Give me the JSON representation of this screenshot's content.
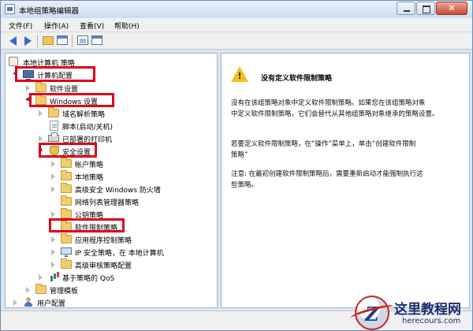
{
  "window": {
    "title": "本地组策略编辑器"
  },
  "menu": [
    {
      "label": "文件(F)"
    },
    {
      "label": "操作(A)"
    },
    {
      "label": "查看(V)"
    },
    {
      "label": "帮助(H)"
    }
  ],
  "tree": {
    "root": "本地计算机 策略",
    "computer_config": "计算机配置",
    "software_settings": "软件设置",
    "windows_settings": "Windows 设置",
    "dns_policy": "域名解析策略",
    "scripts": "脚本(启动/关机)",
    "printers": "已部署的打印机",
    "security_settings": "安全设置",
    "account_policies": "帐户策略",
    "local_policies": "本地策略",
    "firewall": "高级安全 Windows 防火墙",
    "network_list": "网络列表管理器策略",
    "public_key": "公钥策略",
    "software_restriction": "软件限制策略",
    "applocker": "应用程序控制策略",
    "ipsec": "IP 安全策略，在 本地计算机",
    "audit": "高级审核策略配置",
    "qos": "基于策略的 QoS",
    "admin_templates": "管理模板",
    "user_config": "用户配置"
  },
  "detail": {
    "title": "没有定义软件限制策略",
    "para1": [
      "没有在该组策略对象中定义软件限制策略。如果您在该组策略对象",
      "中定义软件限制策略，它们会替代从其他组策略对象继承的策略设置。"
    ],
    "para2": [
      "若要定义软件限制策略，在“操作”菜单上，单击“创建软件限制",
      "策略”"
    ],
    "para3": [
      "注意: 在最初创建软件限制策略后，需要重新启动才能强制执行这",
      "些策略。"
    ]
  },
  "watermark": {
    "site_cn": "这里教程网",
    "site_en": "herecours.com"
  },
  "colors": {
    "highlight": "#e0001a",
    "folder": "#f1cd6f",
    "warning": "#f2c21a"
  }
}
